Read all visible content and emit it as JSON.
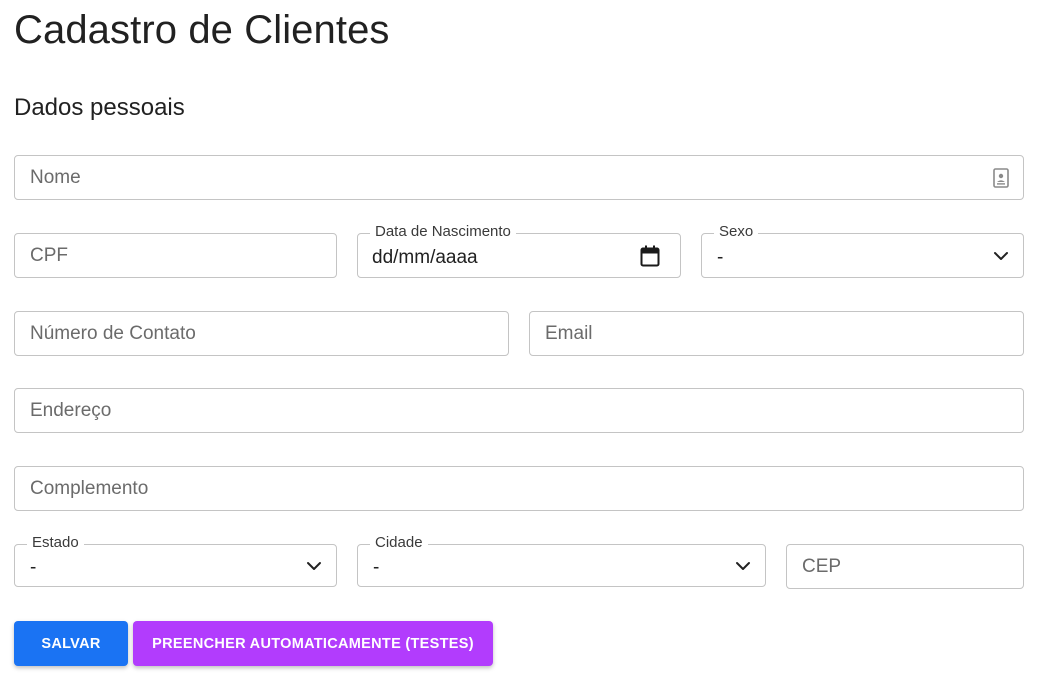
{
  "page": {
    "title": "Cadastro de Clientes",
    "section_title": "Dados pessoais"
  },
  "form": {
    "nome": {
      "placeholder": "Nome",
      "icon": "contact-card-icon"
    },
    "cpf": {
      "placeholder": "CPF"
    },
    "data_nascimento": {
      "label": "Data de Nascimento",
      "value": "dd/mm/aaaa",
      "icon": "calendar-icon"
    },
    "sexo": {
      "label": "Sexo",
      "value": "-",
      "icon": "chevron-down-icon"
    },
    "numero_contato": {
      "placeholder": "Número de Contato"
    },
    "email": {
      "placeholder": "Email"
    },
    "endereco": {
      "placeholder": "Endereço"
    },
    "complemento": {
      "placeholder": "Complemento"
    },
    "estado": {
      "label": "Estado",
      "value": "-",
      "icon": "chevron-down-icon"
    },
    "cidade": {
      "label": "Cidade",
      "value": "-",
      "icon": "chevron-down-icon"
    },
    "cep": {
      "placeholder": "CEP"
    }
  },
  "actions": {
    "save_label": "Salvar",
    "autofill_label": "Preencher automaticamente (testes)"
  },
  "colors": {
    "save_button": "#1a73f3",
    "autofill_button": "#b23cfd",
    "border": "#c4c4c4"
  }
}
